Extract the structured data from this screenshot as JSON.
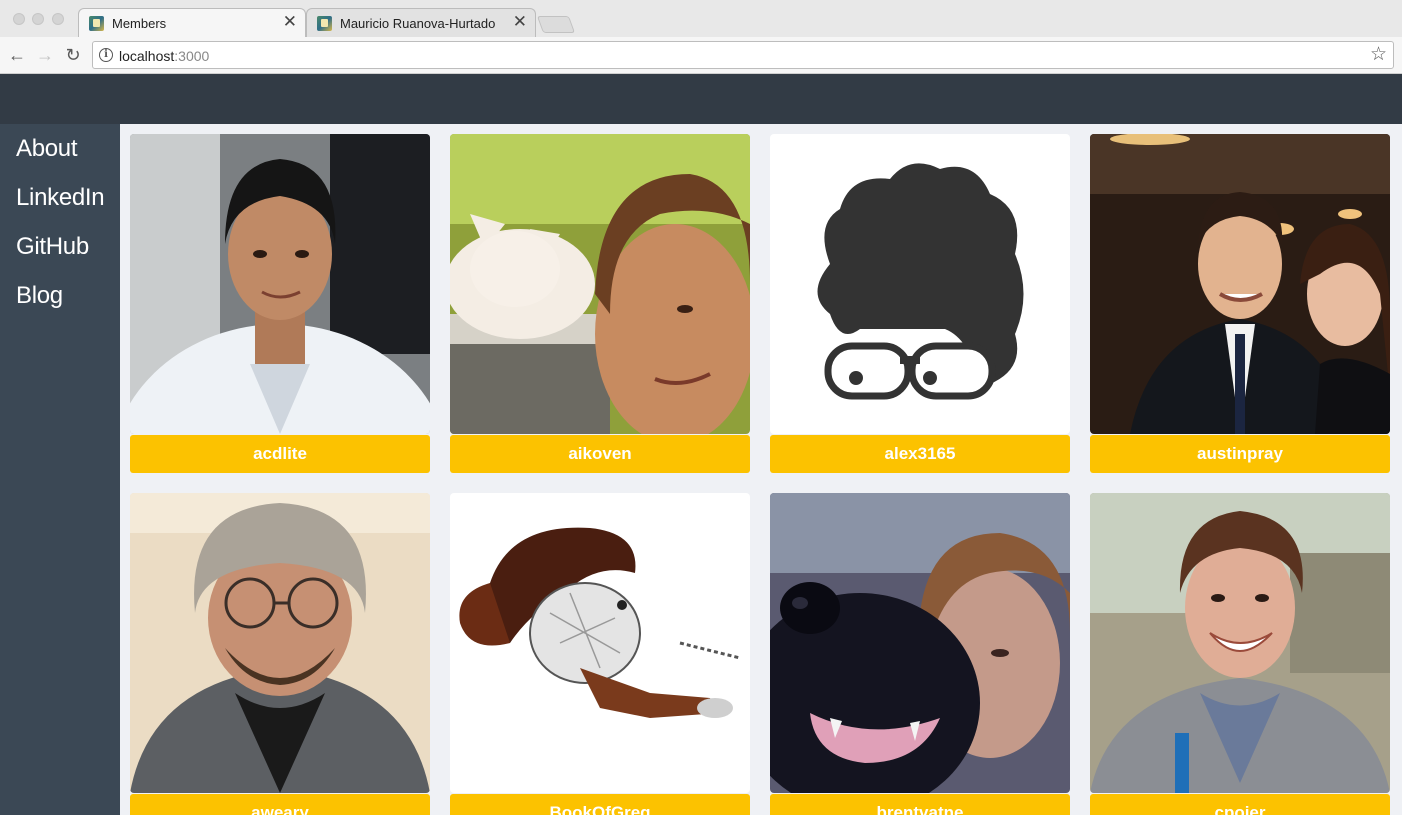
{
  "browser": {
    "tabs": [
      {
        "title": "Members",
        "close": "✕"
      },
      {
        "title": "Mauricio Ruanova-Hurtado",
        "close": "✕"
      }
    ],
    "url_host": "localhost",
    "url_port": ":3000"
  },
  "sidebar": {
    "links": [
      "About",
      "LinkedIn",
      "GitHub",
      "Blog"
    ]
  },
  "members": [
    {
      "username": "acdlite"
    },
    {
      "username": "aikoven"
    },
    {
      "username": "alex3165"
    },
    {
      "username": "austinpray"
    },
    {
      "username": "aweary"
    },
    {
      "username": "BookOfGreg"
    },
    {
      "username": "brentvatne"
    },
    {
      "username": "cpojer"
    }
  ],
  "colors": {
    "header": "#323b45",
    "sidebar": "#3b4855",
    "content_bg": "#eff1f5",
    "name_button": "#fcc200"
  }
}
